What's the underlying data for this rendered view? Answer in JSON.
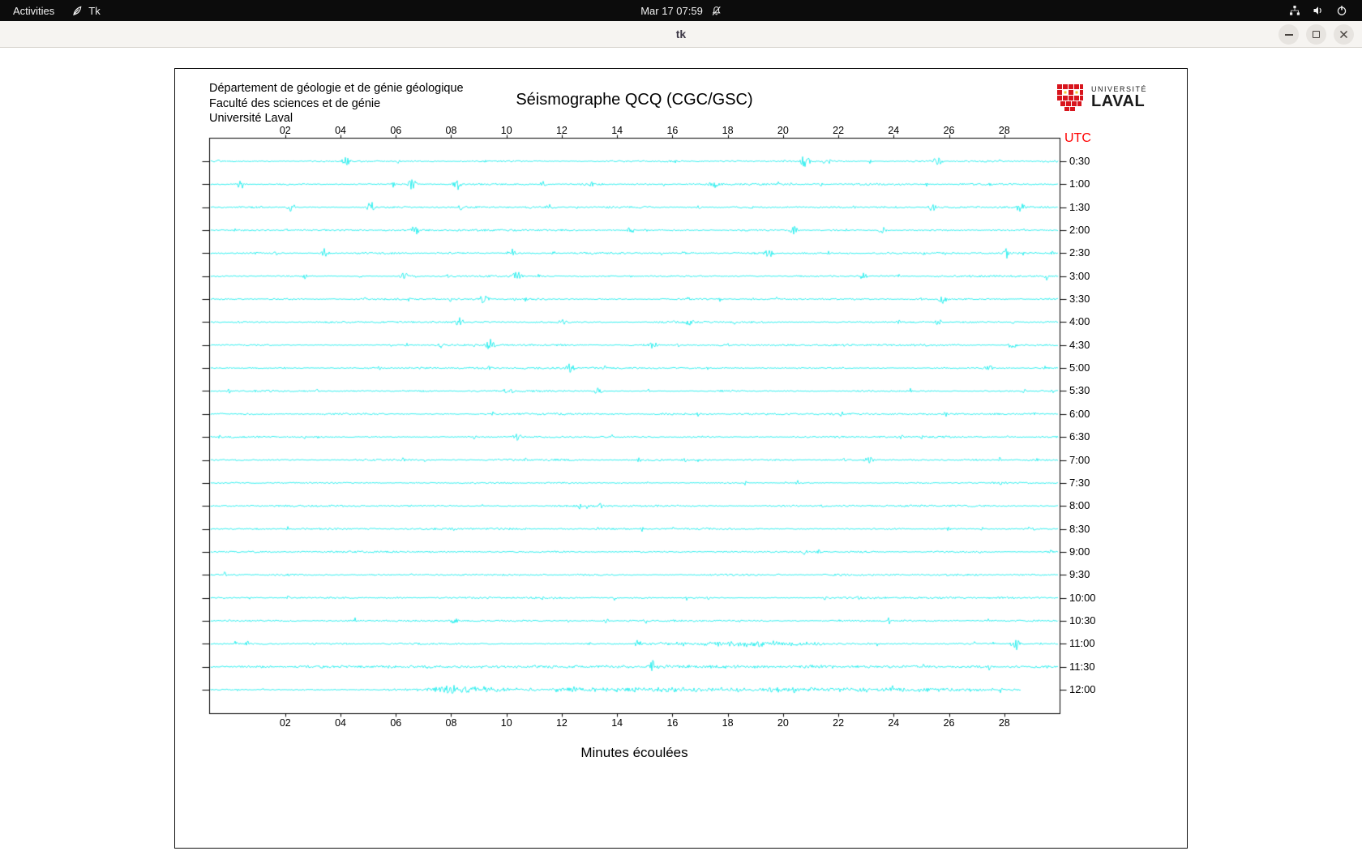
{
  "top_bar": {
    "activities_label": "Activities",
    "app_indicator_label": "Tk",
    "clock": "Mar 17 07:59",
    "icons": {
      "app": "tk-feather-icon",
      "notifications": "notifications-disabled-icon",
      "network": "network-icon",
      "volume": "volume-icon",
      "power": "power-icon"
    }
  },
  "window": {
    "title": "tk",
    "controls": [
      "minimize",
      "maximize",
      "close"
    ]
  },
  "panel": {
    "institution_lines": [
      "Département de géologie et de génie géologique",
      "Faculté des sciences et de génie",
      "Université Laval"
    ],
    "title": "Séismographe QCQ (CGC/GSC)",
    "logo": {
      "line1": "UNIVERSITÉ",
      "line2": "LAVAL",
      "shield_color": "#d8151d",
      "accent_color": "#f2c430"
    },
    "utc_label": "UTC",
    "utc_color": "#ff0000",
    "x_axis_title": "Minutes écoulées",
    "x_ticks": [
      "02",
      "04",
      "06",
      "08",
      "10",
      "12",
      "14",
      "16",
      "18",
      "20",
      "22",
      "24",
      "26",
      "28"
    ],
    "time_labels": [
      "0:30",
      "1:00",
      "1:30",
      "2:00",
      "2:30",
      "3:00",
      "3:30",
      "4:00",
      "4:30",
      "5:00",
      "5:30",
      "6:00",
      "6:30",
      "7:00",
      "7:30",
      "8:00",
      "8:30",
      "9:00",
      "9:30",
      "10:00",
      "10:30",
      "11:00",
      "11:30",
      "12:00"
    ],
    "axis_range_minutes": [
      0,
      30
    ],
    "trace_color": "#00ebeb",
    "last_trace_end_minute": 28.6,
    "events": [
      {
        "time": "0:30",
        "minute": 4.2,
        "amp": 5
      },
      {
        "time": "0:30",
        "minute": 20.8,
        "amp": 8
      },
      {
        "time": "0:30",
        "minute": 25.6,
        "amp": 6
      },
      {
        "time": "1:00",
        "minute": 0.4,
        "amp": 6
      },
      {
        "time": "1:00",
        "minute": 6.6,
        "amp": 7
      },
      {
        "time": "1:00",
        "minute": 8.2,
        "amp": 5
      },
      {
        "time": "1:00",
        "minute": 11.3,
        "amp": 4
      },
      {
        "time": "1:00",
        "minute": 17.5,
        "amp": 4
      },
      {
        "time": "1:30",
        "minute": 2.2,
        "amp": 6
      },
      {
        "time": "1:30",
        "minute": 5.1,
        "amp": 7
      },
      {
        "time": "1:30",
        "minute": 11.6,
        "amp": 4
      },
      {
        "time": "1:30",
        "minute": 25.4,
        "amp": 5
      },
      {
        "time": "1:30",
        "minute": 28.6,
        "amp": 6
      },
      {
        "time": "2:00",
        "minute": 6.7,
        "amp": 7
      },
      {
        "time": "2:00",
        "minute": 14.5,
        "amp": 4
      },
      {
        "time": "2:00",
        "minute": 20.4,
        "amp": 5
      },
      {
        "time": "2:00",
        "minute": 23.6,
        "amp": 4
      },
      {
        "time": "2:30",
        "minute": 3.4,
        "amp": 6
      },
      {
        "time": "2:30",
        "minute": 10.2,
        "amp": 5
      },
      {
        "time": "2:30",
        "minute": 19.5,
        "amp": 6
      },
      {
        "time": "2:30",
        "minute": 28.1,
        "amp": 4
      },
      {
        "time": "3:00",
        "minute": 6.3,
        "amp": 5
      },
      {
        "time": "3:00",
        "minute": 10.4,
        "amp": 5
      },
      {
        "time": "3:00",
        "minute": 22.9,
        "amp": 4
      },
      {
        "time": "3:30",
        "minute": 9.2,
        "amp": 6
      },
      {
        "time": "3:30",
        "minute": 25.8,
        "amp": 5
      },
      {
        "time": "4:00",
        "minute": 8.3,
        "amp": 5
      },
      {
        "time": "4:00",
        "minute": 12.0,
        "amp": 4
      },
      {
        "time": "4:00",
        "minute": 16.6,
        "amp": 4
      },
      {
        "time": "4:00",
        "minute": 25.6,
        "amp": 4
      },
      {
        "time": "4:30",
        "minute": 9.4,
        "amp": 6
      },
      {
        "time": "4:30",
        "minute": 15.3,
        "amp": 4
      },
      {
        "time": "4:30",
        "minute": 28.3,
        "amp": 5
      },
      {
        "time": "5:00",
        "minute": 12.3,
        "amp": 5
      },
      {
        "time": "5:00",
        "minute": 27.4,
        "amp": 5
      },
      {
        "time": "5:30",
        "minute": 13.3,
        "amp": 4
      },
      {
        "time": "6:30",
        "minute": 10.4,
        "amp": 4
      },
      {
        "time": "7:00",
        "minute": 23.1,
        "amp": 4
      },
      {
        "time": "10:30",
        "minute": 8.1,
        "amp": 4
      },
      {
        "time": "11:00",
        "minute": 14.7,
        "amp": 4
      },
      {
        "time": "11:00",
        "minute": 28.4,
        "amp": 10
      },
      {
        "time": "11:30",
        "minute": 15.3,
        "amp": 9
      },
      {
        "time": "12:00",
        "minute": 8.0,
        "amp": 6
      }
    ],
    "bursts": [
      {
        "time": "11:00",
        "from": 14.5,
        "to": 21.5,
        "amp": 3.2
      },
      {
        "time": "11:30",
        "from": 0.5,
        "to": 29.5,
        "amp": 1.4
      },
      {
        "time": "12:00",
        "from": 5.5,
        "to": 28.5,
        "amp": 2.6
      },
      {
        "time": "12:00",
        "from": 7.0,
        "to": 10.0,
        "amp": 3.5
      }
    ]
  }
}
